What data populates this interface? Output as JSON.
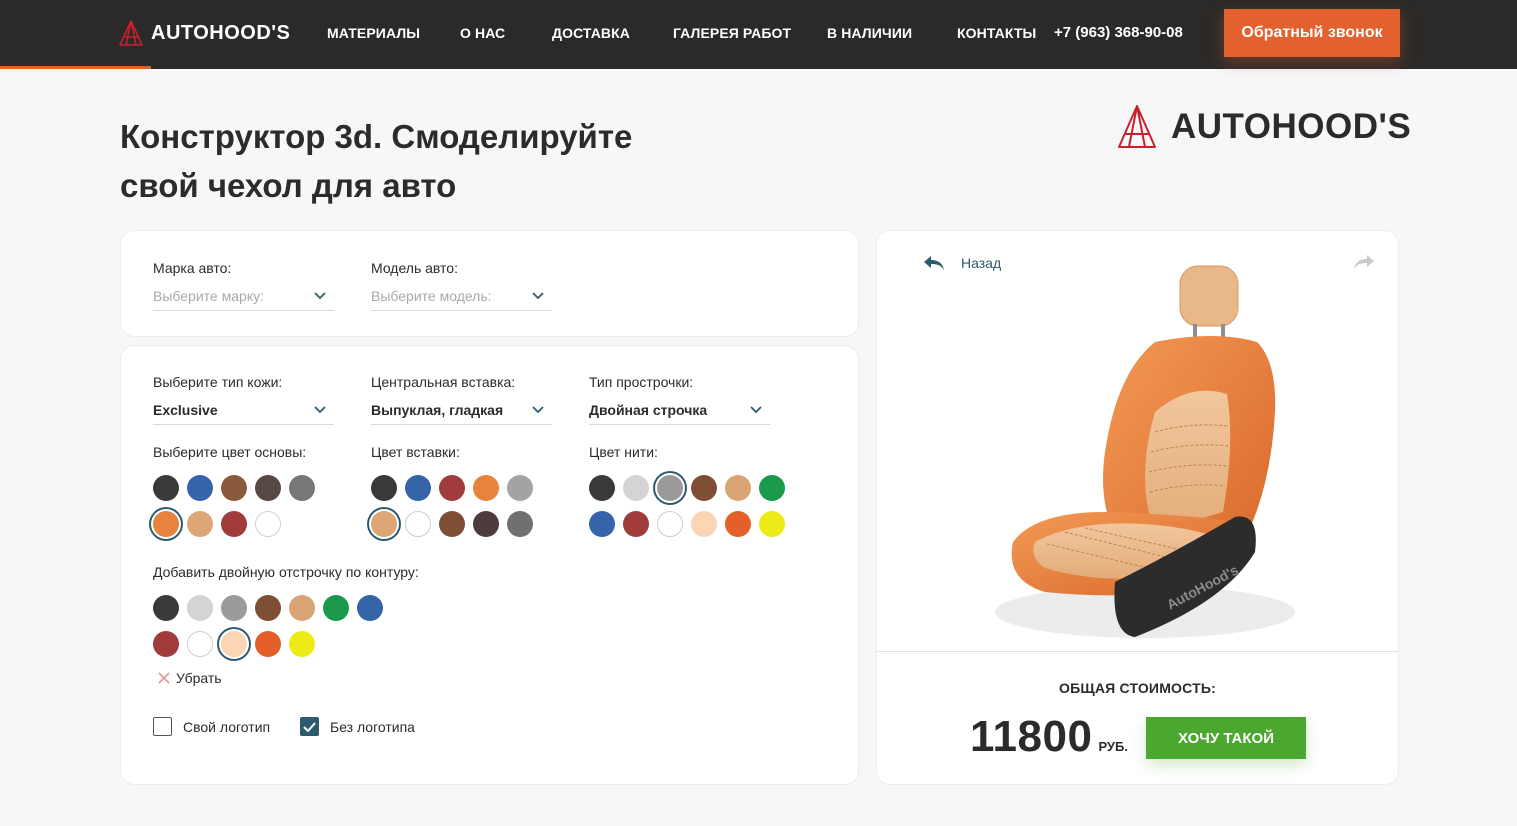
{
  "header": {
    "brand": "AUTOHOOD'S",
    "nav": [
      "МАТЕРИАЛЫ",
      "О НАС",
      "ДОСТАВКА",
      "ГАЛЕРЕЯ РАБОТ",
      "В НАЛИЧИИ",
      "КОНТАКТЫ"
    ],
    "phone": "+7 (963) 368-90-08",
    "callback_label": "Обратный звонок"
  },
  "title_line1": "Конструктор 3d. Смоделируйте",
  "title_line2": "свой чехол для авто",
  "brand_big": "AUTOHOOD'S",
  "car": {
    "make_label": "Марка авто:",
    "make_placeholder": "Выберите марку:",
    "model_label": "Модель авто:",
    "model_placeholder": "Выберите модель:"
  },
  "options": {
    "leather_label": "Выберите тип кожи:",
    "leather_value": "Exclusive",
    "insert_label": "Центральная вставка:",
    "insert_value": "Выпуклая, гладкая",
    "stitch_label": "Тип прострочки:",
    "stitch_value": "Двойная строчка",
    "base_color_label": "Выберите цвет основы:",
    "insert_color_label": "Цвет вставки:",
    "thread_color_label": "Цвет нити:",
    "contour_label": "Добавить двойную отстрочку по контуру:",
    "remove_label": "Убрать",
    "logo_own_label": "Свой логотип",
    "logo_none_label": "Без логотипа",
    "logo_own_checked": false,
    "logo_none_checked": true
  },
  "palettes": {
    "base": [
      {
        "color": "#3a3a3a",
        "selected": false
      },
      {
        "color": "#3564a8",
        "selected": false
      },
      {
        "color": "#8a5a3c",
        "selected": false
      },
      {
        "color": "#574745",
        "selected": false
      },
      {
        "color": "#777777",
        "selected": false
      },
      {
        "color": "#e7823f",
        "selected": true
      },
      {
        "color": "#dda676",
        "selected": false
      },
      {
        "color": "#a23c3c",
        "selected": false
      },
      {
        "color": "#ffffff",
        "selected": false
      }
    ],
    "insert": [
      {
        "color": "#3a3a3a",
        "selected": false
      },
      {
        "color": "#3564a8",
        "selected": false
      },
      {
        "color": "#a23c3c",
        "selected": false
      },
      {
        "color": "#e7823f",
        "selected": false
      },
      {
        "color": "#a3a3a3",
        "selected": false
      },
      {
        "color": "#dda676",
        "selected": true
      },
      {
        "color": "#ffffff",
        "selected": false
      },
      {
        "color": "#7e4f35",
        "selected": false
      },
      {
        "color": "#4e3b3b",
        "selected": false
      },
      {
        "color": "#707070",
        "selected": false
      }
    ],
    "thread": [
      {
        "color": "#3a3a3a",
        "selected": false
      },
      {
        "color": "#d4d4d4",
        "selected": false
      },
      {
        "color": "#9a9a9a",
        "selected": true
      },
      {
        "color": "#7e4f35",
        "selected": false
      },
      {
        "color": "#d9a473",
        "selected": false
      },
      {
        "color": "#1c9a4c",
        "selected": false
      },
      {
        "color": "#3564a8",
        "selected": false
      },
      {
        "color": "#a23c3c",
        "selected": false
      },
      {
        "color": "#ffffff",
        "selected": false
      },
      {
        "color": "#fbd5b4",
        "selected": false
      },
      {
        "color": "#e55f2a",
        "selected": false
      },
      {
        "color": "#eeea17",
        "selected": false
      }
    ],
    "contour": [
      {
        "color": "#3a3a3a",
        "selected": false
      },
      {
        "color": "#d4d4d4",
        "selected": false
      },
      {
        "color": "#9a9a9a",
        "selected": false
      },
      {
        "color": "#7e4f35",
        "selected": false
      },
      {
        "color": "#d9a473",
        "selected": false
      },
      {
        "color": "#1c9a4c",
        "selected": false
      },
      {
        "color": "#3564a8",
        "selected": false
      },
      {
        "color": "#a23c3c",
        "selected": false
      },
      {
        "color": "#ffffff",
        "selected": false
      },
      {
        "color": "#fbd5b4",
        "selected": true
      },
      {
        "color": "#e55f2a",
        "selected": false
      },
      {
        "color": "#eeea17",
        "selected": false
      }
    ]
  },
  "preview": {
    "back_label": "Назад",
    "seat_brand": "AutoHood's",
    "total_label": "ОБЩАЯ СТОИМОСТЬ:",
    "price": "11800",
    "currency": "РУБ.",
    "buy_label": "ХОЧУ ТАКОЙ"
  },
  "colors": {
    "accent": "#e2612f",
    "buy": "#4aa730",
    "header_bg": "#2c2a29",
    "link": "#2e5a6f"
  }
}
